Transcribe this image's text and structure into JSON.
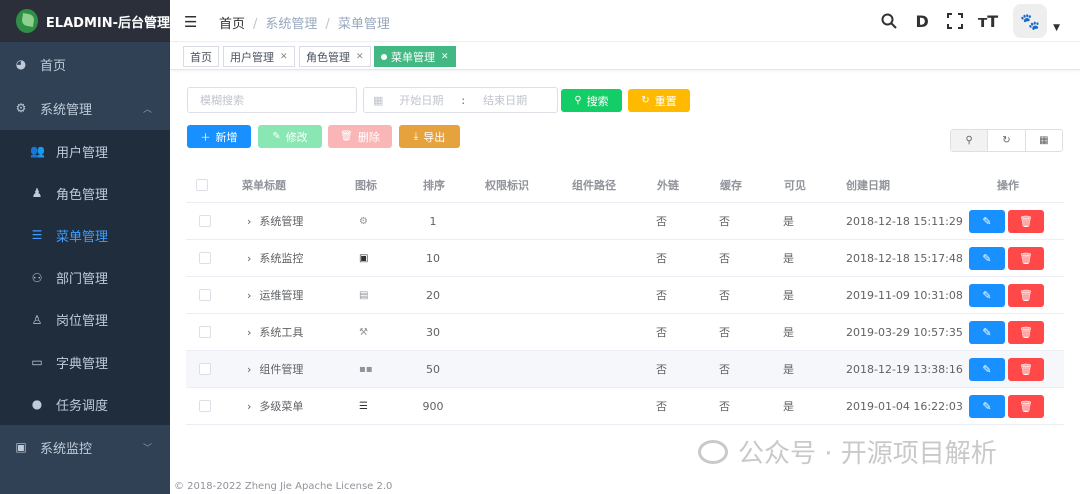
{
  "app": {
    "title": "ELADMIN-后台管理"
  },
  "sidebar": {
    "home": {
      "label": "首页",
      "icon": "dashboard-icon"
    },
    "system": {
      "label": "系统管理",
      "icon": "gear-icon"
    },
    "items": [
      {
        "label": "用户管理",
        "icon": "user-icon"
      },
      {
        "label": "角色管理",
        "icon": "role-icon"
      },
      {
        "label": "菜单管理",
        "icon": "menu-icon"
      },
      {
        "label": "部门管理",
        "icon": "dept-icon"
      },
      {
        "label": "岗位管理",
        "icon": "post-icon"
      },
      {
        "label": "字典管理",
        "icon": "dict-icon"
      },
      {
        "label": "任务调度",
        "icon": "timing-icon"
      }
    ],
    "monitor": {
      "label": "系统监控",
      "icon": "monitor-icon"
    }
  },
  "breadcrumb": [
    "首页",
    "系统管理",
    "菜单管理"
  ],
  "tags": [
    {
      "label": "首页",
      "active": false
    },
    {
      "label": "用户管理",
      "active": false
    },
    {
      "label": "角色管理",
      "active": false
    },
    {
      "label": "菜单管理",
      "active": true
    }
  ],
  "search": {
    "keyword_placeholder": "模糊搜索",
    "start_placeholder": "开始日期",
    "range_sep": ":",
    "end_placeholder": "结束日期",
    "search_label": "搜索",
    "reset_label": "重置"
  },
  "toolbar": {
    "add_label": "新增",
    "edit_label": "修改",
    "delete_label": "删除",
    "export_label": "导出"
  },
  "table": {
    "headers": [
      "菜单标题",
      "图标",
      "排序",
      "权限标识",
      "组件路径",
      "外链",
      "缓存",
      "可见",
      "创建日期",
      "操作"
    ],
    "rows": [
      {
        "title": "系统管理",
        "icon": "system-icon",
        "sort": "1",
        "permission": "",
        "component": "",
        "iframe": "否",
        "cache": "否",
        "hidden": "是",
        "date": "2018-12-18 15:11:29"
      },
      {
        "title": "系统监控",
        "icon": "monitor-icon",
        "sort": "10",
        "permission": "",
        "component": "",
        "iframe": "否",
        "cache": "否",
        "hidden": "是",
        "date": "2018-12-18 15:17:48"
      },
      {
        "title": "运维管理",
        "icon": "mnt-icon",
        "sort": "20",
        "permission": "",
        "component": "",
        "iframe": "否",
        "cache": "否",
        "hidden": "是",
        "date": "2019-11-09 10:31:08"
      },
      {
        "title": "系统工具",
        "icon": "tools-icon",
        "sort": "30",
        "permission": "",
        "component": "",
        "iframe": "否",
        "cache": "否",
        "hidden": "是",
        "date": "2019-03-29 10:57:35"
      },
      {
        "title": "组件管理",
        "icon": "zujian-icon",
        "sort": "50",
        "permission": "",
        "component": "",
        "iframe": "否",
        "cache": "否",
        "hidden": "是",
        "date": "2018-12-19 13:38:16"
      },
      {
        "title": "多级菜单",
        "icon": "menu-icon",
        "sort": "900",
        "permission": "",
        "component": "",
        "iframe": "否",
        "cache": "否",
        "hidden": "是",
        "date": "2019-01-04 16:22:03"
      }
    ]
  },
  "watermark": "公众号 · 开源项目解析",
  "footer": "© 2018-2022 Zheng Jie Apache License 2.0",
  "colors": {
    "sidebar_bg": "#304156",
    "sidebar_active_text": "#409eff",
    "tag_active": "#42b983",
    "primary": "#1890ff",
    "success": "#13ce66",
    "warning": "#ffba00",
    "danger": "#ff4949"
  }
}
